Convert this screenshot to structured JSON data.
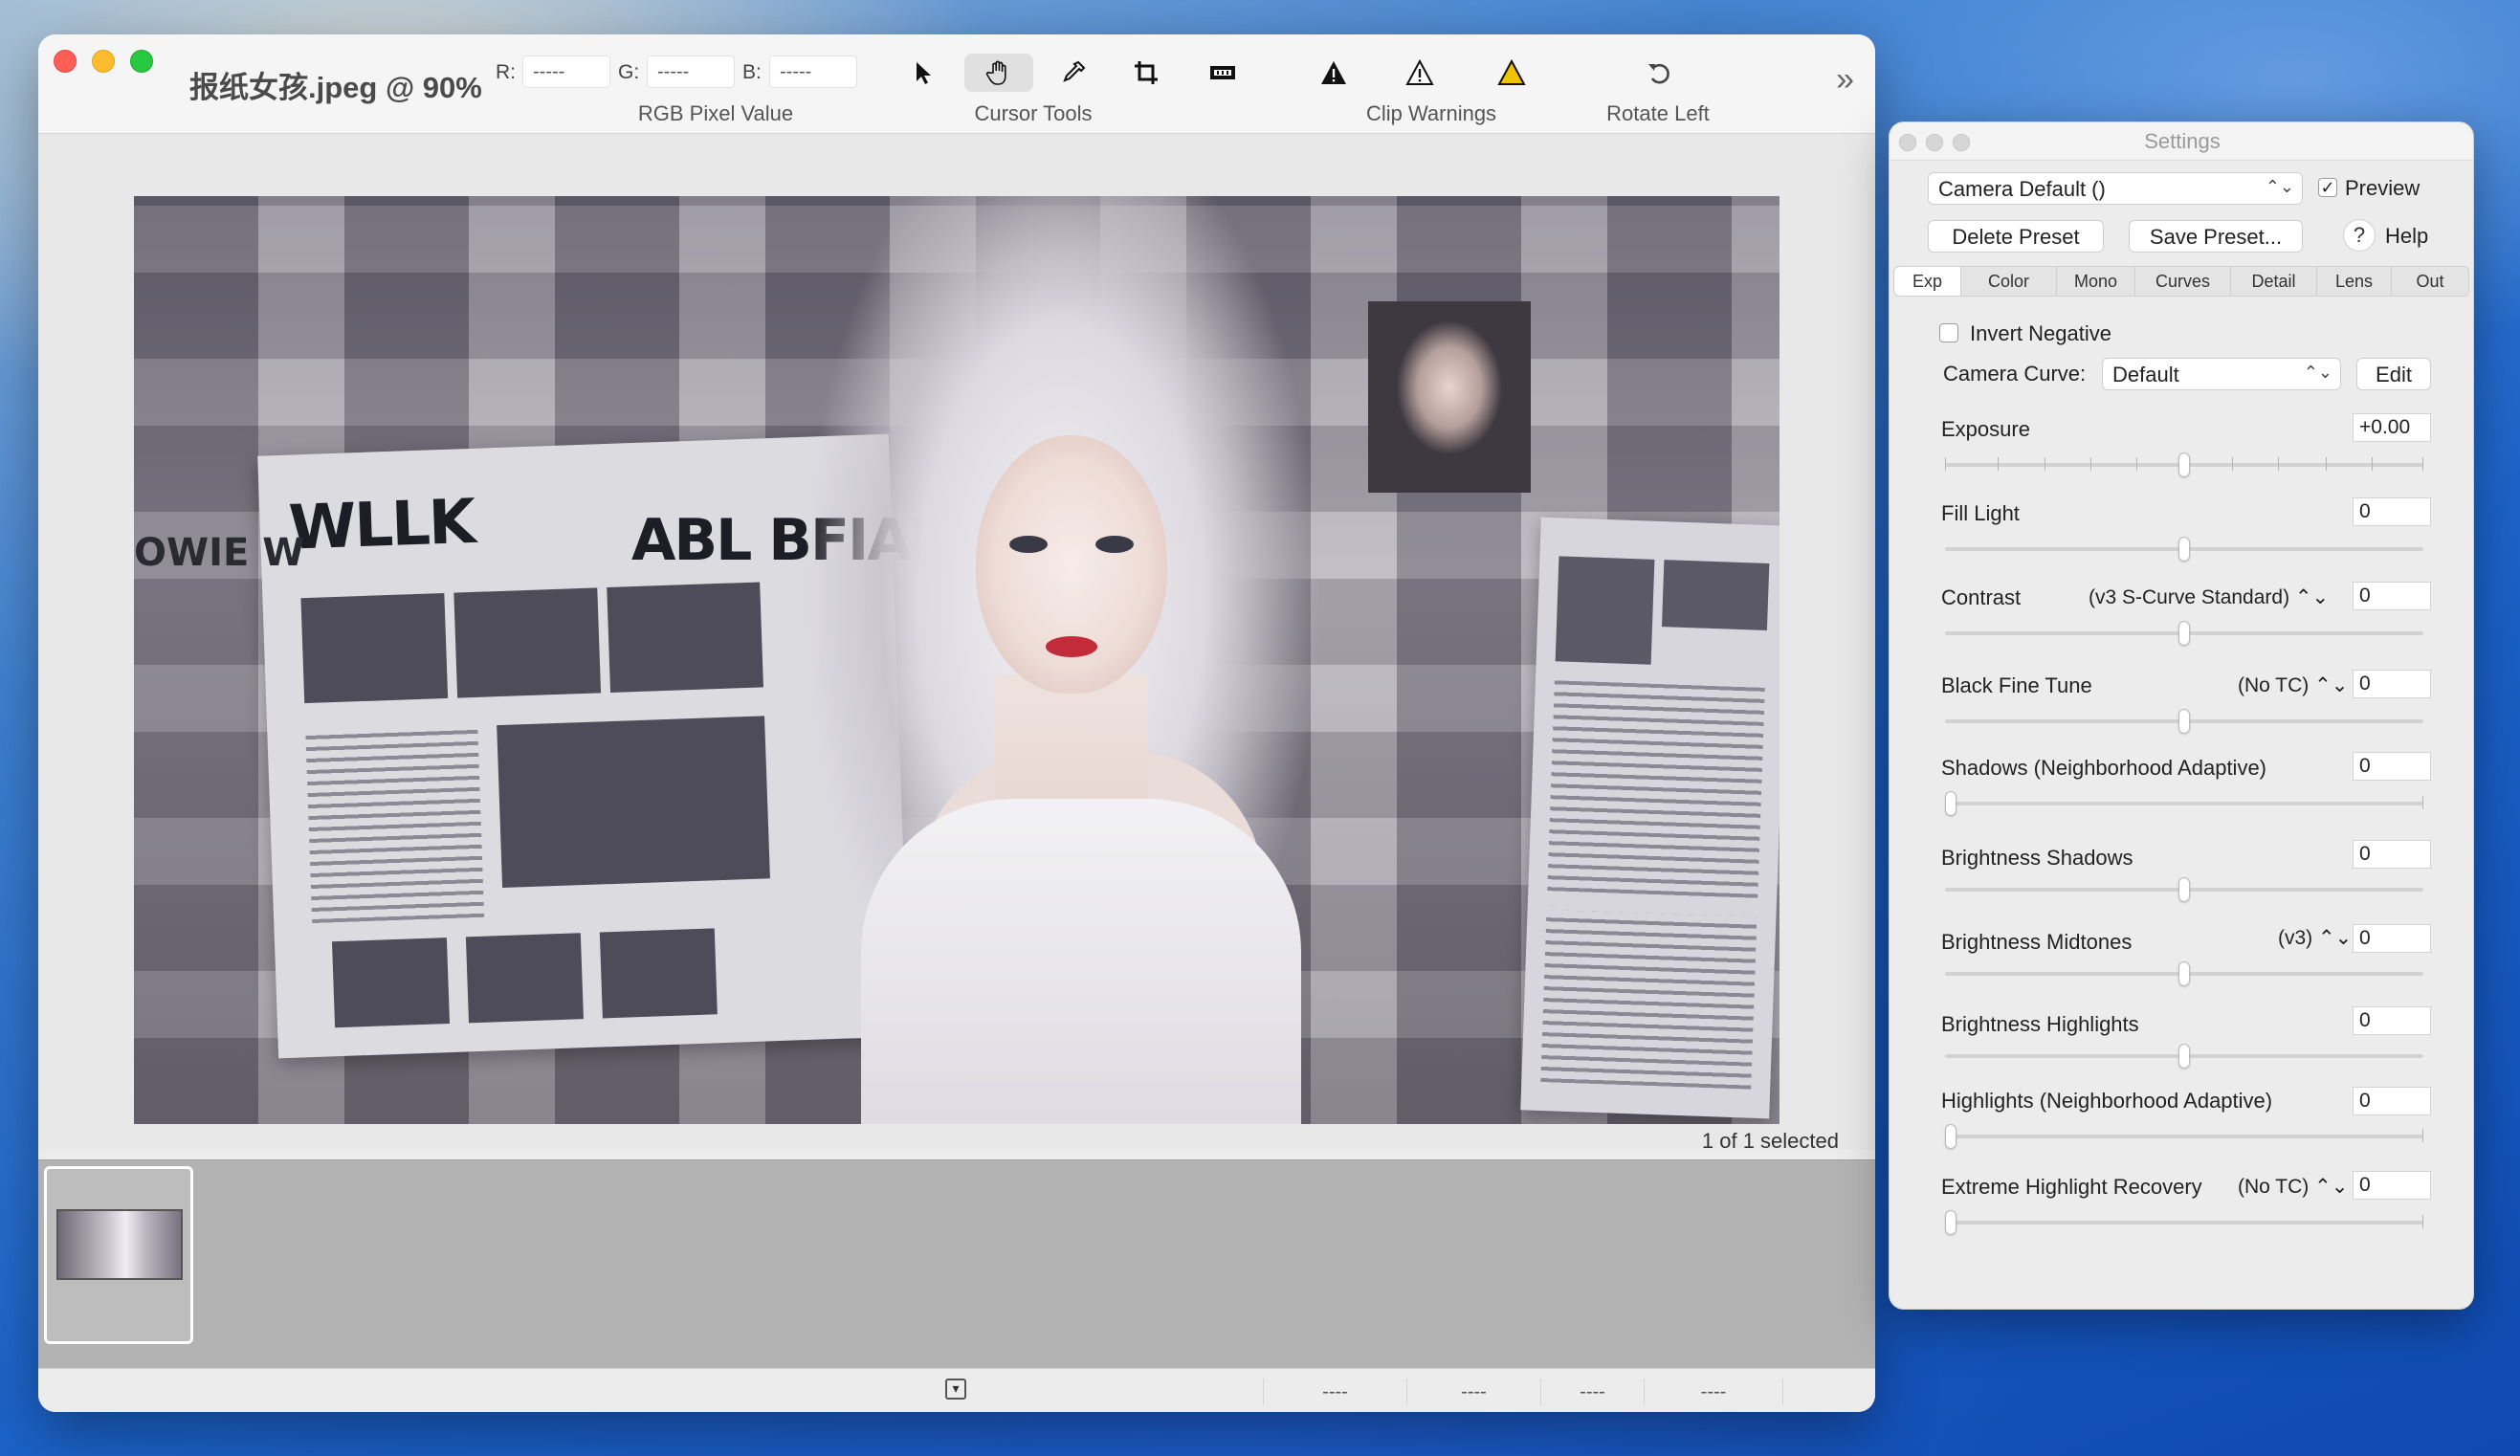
{
  "colors": {
    "traffic_red": "#ff5f57",
    "traffic_yellow": "#febc2e",
    "traffic_green": "#28c840",
    "clip_warning_yellow": "#f2c200"
  },
  "main_window": {
    "title": "报纸女孩.jpeg @ 90%",
    "rgb": {
      "r_label": "R:",
      "r_value": "-----",
      "g_label": "G:",
      "g_value": "-----",
      "b_label": "B:",
      "b_value": "-----",
      "caption": "RGB Pixel Value"
    },
    "toolbar": {
      "cursor_tools_caption": "Cursor Tools",
      "clip_warnings_caption": "Clip Warnings",
      "rotate_left_caption": "Rotate Left",
      "tools": [
        "arrow-pointer-icon",
        "hand-pan-icon",
        "eyedropper-icon",
        "crop-icon",
        "film-frame-icon"
      ],
      "warnings": [
        "shadow-clip-warning-icon",
        "highlight-clip-warning-icon",
        "yellow-clip-warning-icon"
      ],
      "overflow": "»"
    },
    "image": {
      "headline_left": "WLLK",
      "headline_center": "ABL BFIAET",
      "headline_edge": "OWIE W"
    },
    "selection_status": "1 of 1 selected",
    "statusbar": {
      "cells": [
        "----",
        "----",
        "----",
        "----"
      ]
    }
  },
  "settings": {
    "title": "Settings",
    "preset_select": "Camera Default ()",
    "preview_label": "Preview",
    "preview_checked": "✓",
    "delete_preset": "Delete Preset",
    "save_preset": "Save Preset...",
    "help_symbol": "?",
    "help_label": "Help",
    "tabs": [
      "Exp",
      "Color",
      "Mono",
      "Curves",
      "Detail",
      "Lens",
      "Out"
    ],
    "active_tab": "Exp",
    "invert_negative": "Invert Negative",
    "camera_curve_label": "Camera Curve:",
    "camera_curve_value": "Default",
    "edit_button": "Edit",
    "controls": {
      "exposure": {
        "label": "Exposure",
        "value": "+0.00",
        "level": 0.5
      },
      "fill_light": {
        "label": "Fill Light",
        "value": "0",
        "level": 0.5
      },
      "contrast": {
        "label": "Contrast",
        "mode": "(v3 S-Curve Standard) ⌃⌄",
        "value": "0",
        "level": 0.5
      },
      "black_fine_tune": {
        "label": "Black Fine Tune",
        "mode": "(No TC) ⌃⌄",
        "value": "0",
        "level": 0.5
      },
      "shadows_na": {
        "label": "Shadows (Neighborhood Adaptive)",
        "value": "0",
        "level": 0.0
      },
      "brightness_shadows": {
        "label": "Brightness Shadows",
        "value": "0",
        "level": 0.5
      },
      "brightness_midtones": {
        "label": "Brightness Midtones",
        "mode": "(v3) ⌃⌄",
        "value": "0",
        "level": 0.5
      },
      "brightness_highlights": {
        "label": "Brightness Highlights",
        "value": "0",
        "level": 0.5
      },
      "highlights_na": {
        "label": "Highlights (Neighborhood Adaptive)",
        "value": "0",
        "level": 0.0
      },
      "extreme_highlight_recovery": {
        "label": "Extreme Highlight Recovery",
        "mode": "(No TC) ⌃⌄",
        "value": "0",
        "level": 0.0
      }
    }
  }
}
